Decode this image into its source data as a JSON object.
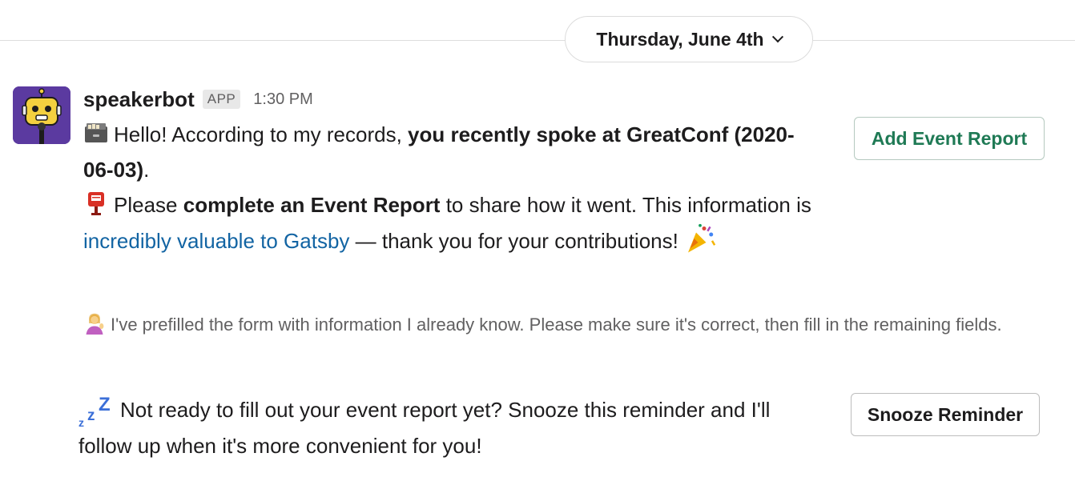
{
  "date_divider": {
    "label": "Thursday, June 4th"
  },
  "message": {
    "sender": "speakerbot",
    "badge": "APP",
    "time": "1:30 PM",
    "line1": {
      "emoji": "file-cabinet-icon",
      "text_before": "Hello! According to my records, ",
      "bold": "you recently spoke at GreatConf (2020-06-03)",
      "text_after": "."
    },
    "line2": {
      "emoji": "postbox-icon",
      "text_before": "Please ",
      "bold": "complete an Event Report",
      "text_middle": " to share how it went. This information is ",
      "link": "incredibly valuable to Gatsby",
      "text_after": " — thank you for your contributions! ",
      "emoji_end": "party-popper-icon"
    },
    "context": {
      "emoji": "woman-tipping-hand-icon",
      "text": "I've prefilled the form with information I already know. Please make sure it's correct, then fill in the remaining fields."
    },
    "snooze": {
      "emoji": "zzz-icon",
      "text": "Not ready to fill out your event report yet? Snooze this reminder and I'll follow up when it's more convenient for you!"
    }
  },
  "buttons": {
    "add_event_report": "Add Event Report",
    "snooze_reminder": "Snooze Reminder"
  },
  "colors": {
    "link": "#1264a3",
    "add_button_text": "#1f7a55",
    "avatar_bg": "#5b3aa0"
  }
}
